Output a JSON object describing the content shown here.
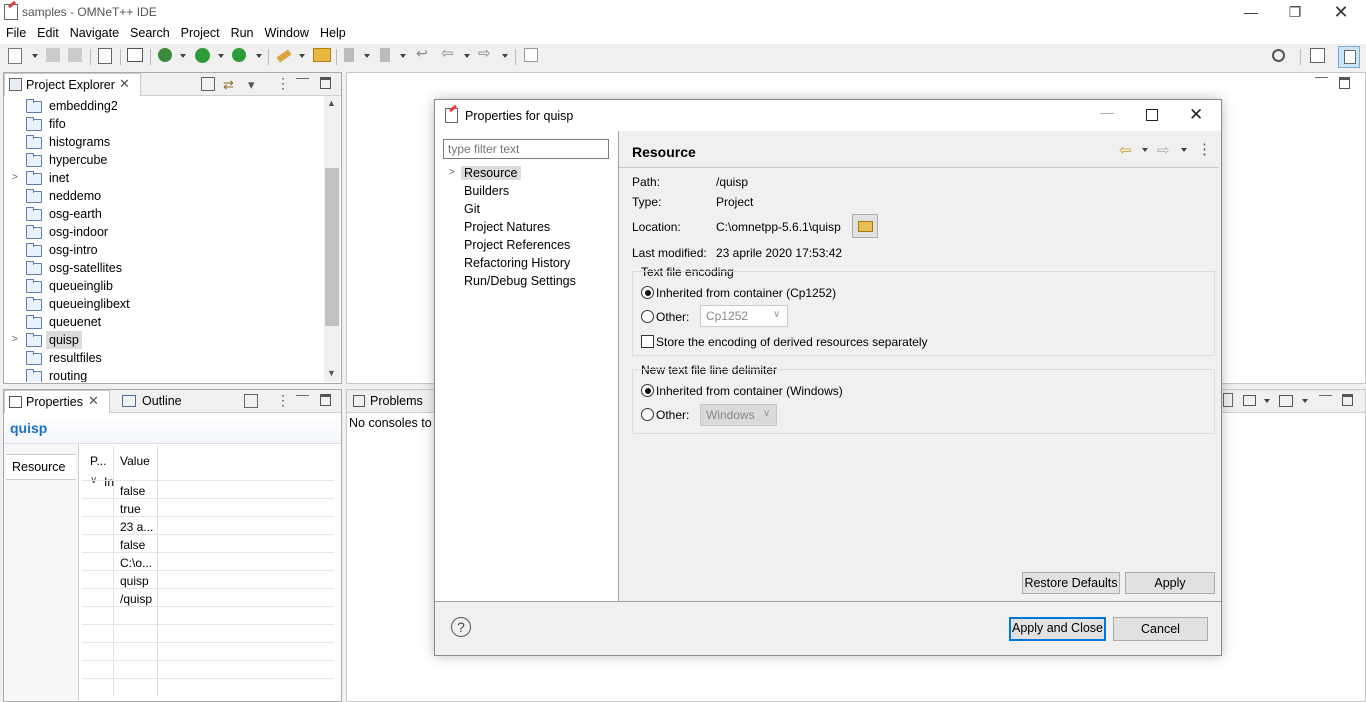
{
  "window": {
    "title": "samples - OMNeT++ IDE"
  },
  "menu": [
    "File",
    "Edit",
    "Navigate",
    "Search",
    "Project",
    "Run",
    "Window",
    "Help"
  ],
  "project_explorer": {
    "tab_label": "Project Explorer",
    "items": [
      {
        "label": "embedding2",
        "expandable": false
      },
      {
        "label": "fifo",
        "expandable": false
      },
      {
        "label": "histograms",
        "expandable": false
      },
      {
        "label": "hypercube",
        "expandable": false
      },
      {
        "label": "inet",
        "expandable": true
      },
      {
        "label": "neddemo",
        "expandable": false
      },
      {
        "label": "osg-earth",
        "expandable": false
      },
      {
        "label": "osg-indoor",
        "expandable": false
      },
      {
        "label": "osg-intro",
        "expandable": false
      },
      {
        "label": "osg-satellites",
        "expandable": false
      },
      {
        "label": "queueinglib",
        "expandable": false
      },
      {
        "label": "queueinglibext",
        "expandable": false
      },
      {
        "label": "queuenet",
        "expandable": false
      },
      {
        "label": "quisp",
        "expandable": true,
        "selected": true
      },
      {
        "label": "resultfiles",
        "expandable": false
      },
      {
        "label": "routing",
        "expandable": false
      }
    ]
  },
  "properties_view": {
    "tab_label": "Properties",
    "outline_tab_label": "Outline",
    "title": "quisp",
    "side_tab": "Resource",
    "col_property": "P...",
    "col_value": "Value",
    "group_label": "In",
    "values": [
      "false",
      "true",
      "23 a...",
      "false",
      "C:\\o...",
      "quisp",
      "/quisp"
    ]
  },
  "bottom_view": {
    "problems_tab": "Problems",
    "console_text": "No consoles to d"
  },
  "dialog": {
    "title": "Properties for quisp",
    "filter_placeholder": "type filter text",
    "nav_items": [
      "Resource",
      "Builders",
      "Git",
      "Project Natures",
      "Project References",
      "Refactoring History",
      "Run/Debug Settings"
    ],
    "page_title": "Resource",
    "path_label": "Path:",
    "path_value": "/quisp",
    "type_label": "Type:",
    "type_value": "Project",
    "location_label": "Location:",
    "location_value": "C:\\omnetpp-5.6.1\\quisp",
    "modified_label": "Last modified:",
    "modified_value": "23 aprile 2020 17:53:42",
    "encoding_group": "Text file encoding",
    "encoding_inherited": "Inherited from container (Cp1252)",
    "encoding_other": "Other:",
    "encoding_combo": "Cp1252",
    "store_encoding": "Store the encoding of derived resources separately",
    "delimiter_group": "New text file line delimiter",
    "delimiter_inherited": "Inherited from container (Windows)",
    "delimiter_other": "Other:",
    "delimiter_combo": "Windows",
    "restore_defaults": "Restore Defaults",
    "apply": "Apply",
    "apply_close": "Apply and Close",
    "cancel": "Cancel",
    "help_icon": "?"
  },
  "colors": {
    "accent": "#0078d7",
    "link_title": "#1a73c8",
    "selection": "#dbdbdb"
  }
}
